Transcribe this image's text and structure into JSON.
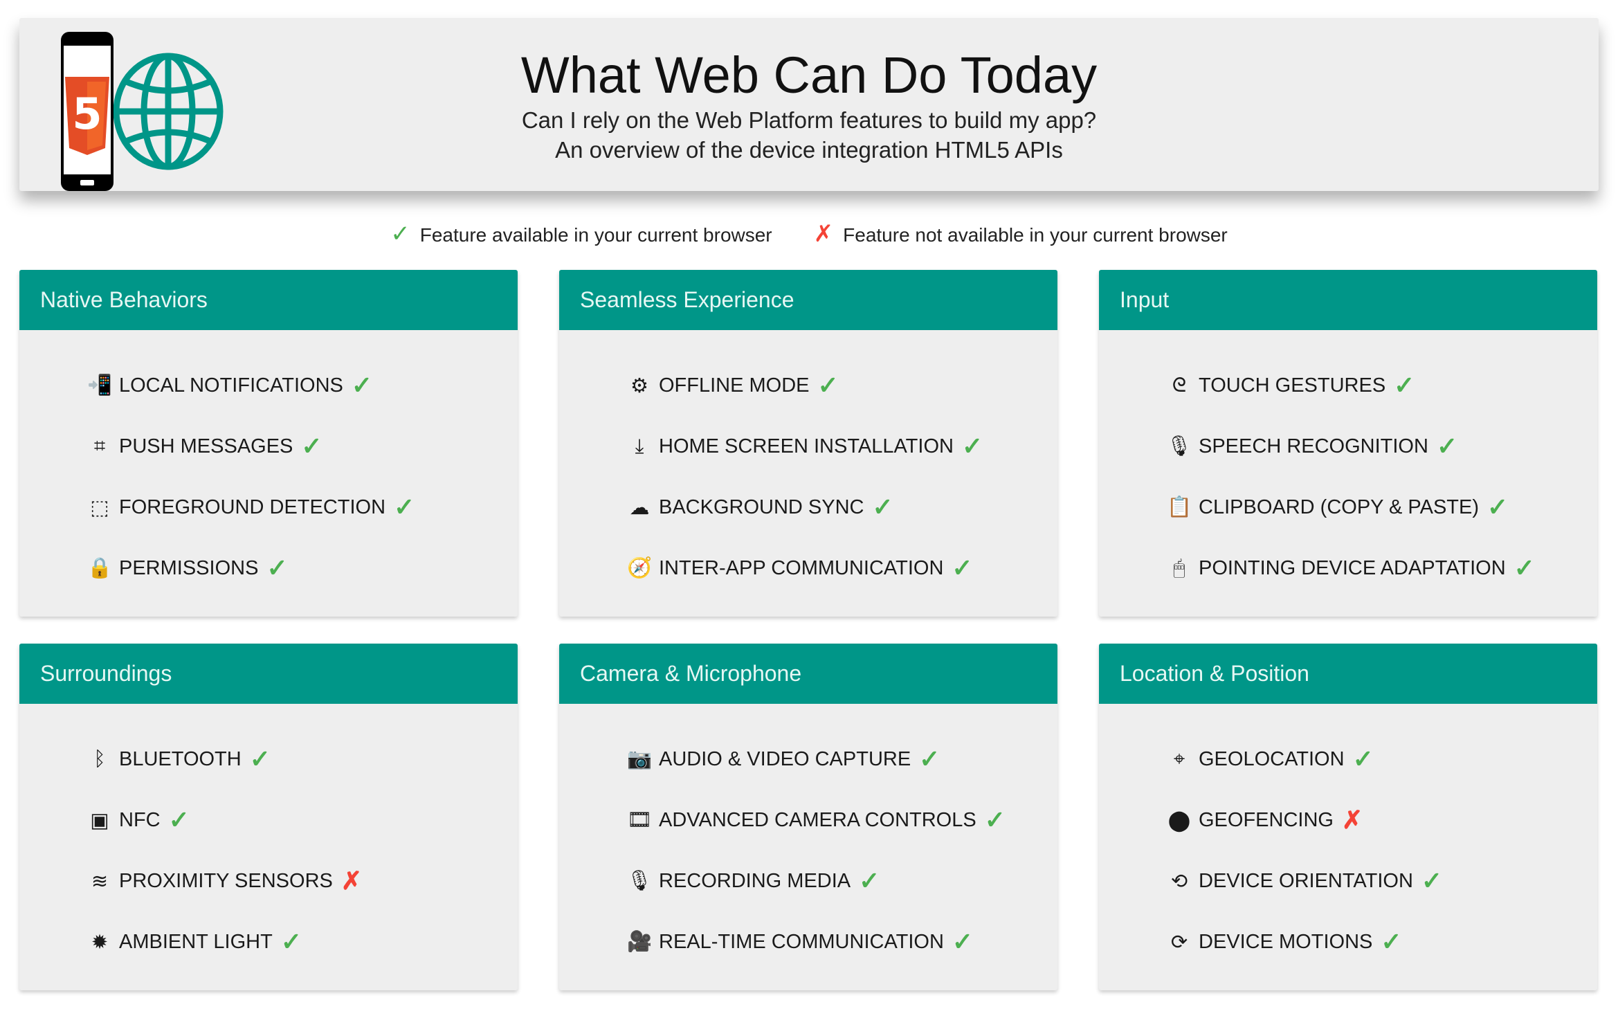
{
  "header": {
    "title": "What Web Can Do Today",
    "subtitle1": "Can I rely on the Web Platform features to build my app?",
    "subtitle2": "An overview of the device integration HTML5 APIs",
    "logo_text": "5"
  },
  "legend": {
    "available": "Feature available in your current browser",
    "unavailable": "Feature not available in your current browser"
  },
  "colors": {
    "accent": "#009688",
    "available": "#4caf50",
    "unavailable": "#f44336"
  },
  "categories": [
    {
      "title": "Native Behaviors",
      "items": [
        {
          "label": "Local Notifications",
          "icon": "phone-download-icon",
          "available": true
        },
        {
          "label": "Push Messages",
          "icon": "cast-icon",
          "available": true
        },
        {
          "label": "Foreground Detection",
          "icon": "select-window-icon",
          "available": true
        },
        {
          "label": "Permissions",
          "icon": "lock-icon",
          "available": true
        }
      ]
    },
    {
      "title": "Seamless Experience",
      "items": [
        {
          "label": "Offline Mode",
          "icon": "gear-box-icon",
          "available": true
        },
        {
          "label": "Home Screen Installation",
          "icon": "download-icon",
          "available": true
        },
        {
          "label": "Background Sync",
          "icon": "cloud-upload-icon",
          "available": true
        },
        {
          "label": "Inter-App Communication",
          "icon": "compass-icon",
          "available": true
        }
      ]
    },
    {
      "title": "Input",
      "items": [
        {
          "label": "Touch Gestures",
          "icon": "gesture-icon",
          "available": true
        },
        {
          "label": "Speech Recognition",
          "icon": "microphone-icon",
          "available": true
        },
        {
          "label": "Clipboard (Copy & Paste)",
          "icon": "clipboard-icon",
          "available": true
        },
        {
          "label": "Pointing Device Adaptation",
          "icon": "mouse-icon",
          "available": true
        }
      ]
    },
    {
      "title": "Surroundings",
      "items": [
        {
          "label": "Bluetooth",
          "icon": "bluetooth-icon",
          "available": true
        },
        {
          "label": "NFC",
          "icon": "nfc-icon",
          "available": true
        },
        {
          "label": "Proximity Sensors",
          "icon": "proximity-icon",
          "available": false
        },
        {
          "label": "Ambient Light",
          "icon": "brightness-icon",
          "available": true
        }
      ]
    },
    {
      "title": "Camera & Microphone",
      "items": [
        {
          "label": "Audio & Video Capture",
          "icon": "camera-icon",
          "available": true
        },
        {
          "label": "Advanced Camera Controls",
          "icon": "camera-roll-icon",
          "available": true
        },
        {
          "label": "Recording Media",
          "icon": "microphone-icon",
          "available": true
        },
        {
          "label": "Real-Time Communication",
          "icon": "video-camera-icon",
          "available": true
        }
      ]
    },
    {
      "title": "Location & Position",
      "items": [
        {
          "label": "Geolocation",
          "icon": "crosshair-icon",
          "available": true
        },
        {
          "label": "Geofencing",
          "icon": "geofence-icon",
          "available": false
        },
        {
          "label": "Device Orientation",
          "icon": "screen-rotation-icon",
          "available": true
        },
        {
          "label": "Device Motions",
          "icon": "3d-rotation-icon",
          "available": true
        }
      ]
    }
  ]
}
